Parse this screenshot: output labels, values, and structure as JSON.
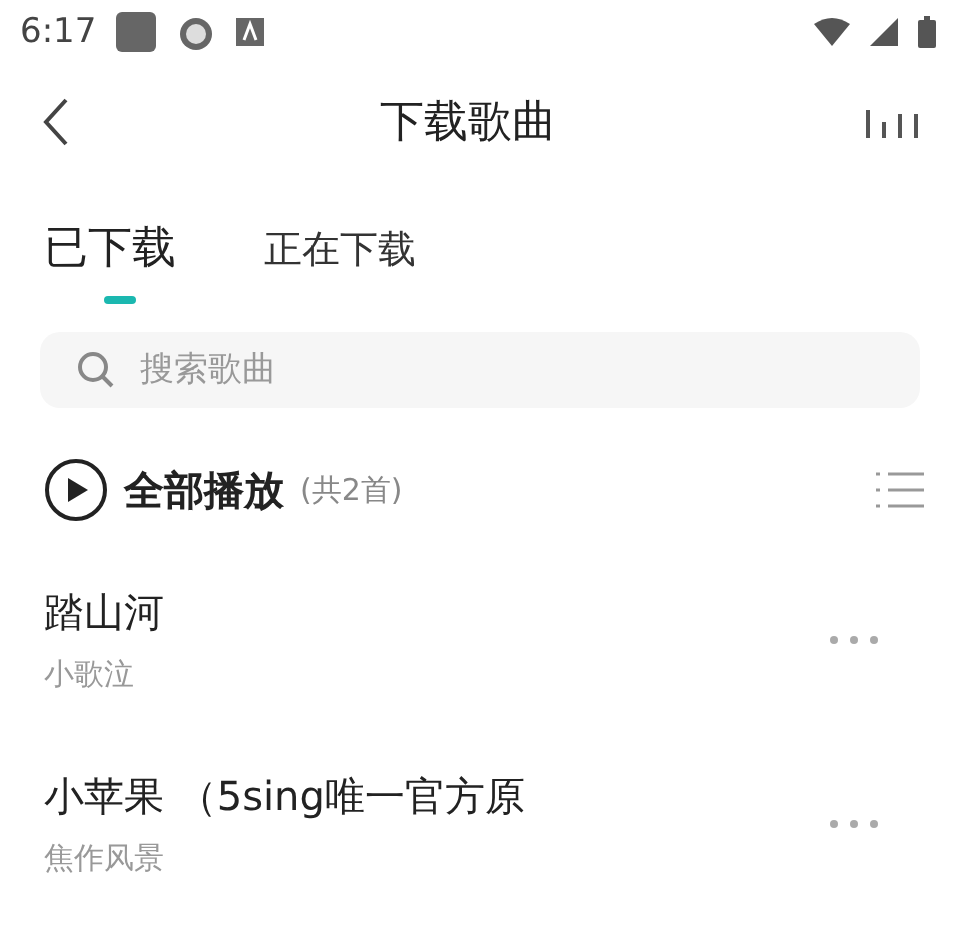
{
  "status_bar": {
    "time": "6:17"
  },
  "header": {
    "title": "下载歌曲"
  },
  "tabs": [
    {
      "label": "已下载",
      "selected": true
    },
    {
      "label": "正在下载",
      "selected": false
    }
  ],
  "search": {
    "placeholder": "搜索歌曲"
  },
  "play_all": {
    "label": "全部播放",
    "count": "(共2首)"
  },
  "songs": [
    {
      "title": "踏山河",
      "artist": "小歌泣"
    },
    {
      "title": "小苹果 （5sing唯一官方原",
      "artist": "焦作风景"
    }
  ]
}
